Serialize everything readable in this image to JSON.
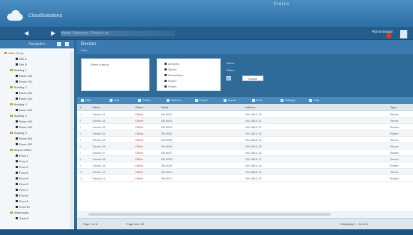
{
  "header": {
    "app_name": "CloudSolutions",
    "top_text": "Status",
    "nav_back": "◀",
    "nav_fwd": "▶",
    "breadcrumb": "Home / Inventory / Device List",
    "user": "Administrator"
  },
  "left_panel": {
    "title": "Navigation",
    "tree": [
      {
        "label": "Main Group",
        "kind": "folder",
        "indent": 0,
        "selected": true
      },
      {
        "label": "Site A",
        "kind": "node",
        "indent": 2
      },
      {
        "label": "Site B",
        "kind": "node",
        "indent": 2
      },
      {
        "label": "Building 1",
        "kind": "folder",
        "indent": 1
      },
      {
        "label": "Room 101",
        "kind": "node",
        "indent": 2
      },
      {
        "label": "Room 102",
        "kind": "node",
        "indent": 2
      },
      {
        "label": "Building 2",
        "kind": "folder",
        "indent": 1
      },
      {
        "label": "Room 201",
        "kind": "node",
        "indent": 2
      },
      {
        "label": "Room 202",
        "kind": "node",
        "indent": 2
      },
      {
        "label": "Building 3",
        "kind": "folder",
        "indent": 1
      },
      {
        "label": "Room 301",
        "kind": "node",
        "indent": 2
      },
      {
        "label": "Building 4",
        "kind": "folder",
        "indent": 1
      },
      {
        "label": "Room 401",
        "kind": "node",
        "indent": 2
      },
      {
        "label": "Room 402",
        "kind": "node",
        "indent": 2
      },
      {
        "label": "Building 5",
        "kind": "folder",
        "indent": 1
      },
      {
        "label": "Room 501",
        "kind": "node",
        "indent": 2
      },
      {
        "label": "Room 502",
        "kind": "node",
        "indent": 2
      },
      {
        "label": "Branch Office",
        "kind": "folder",
        "indent": 1
      },
      {
        "label": "Floor 1",
        "kind": "node",
        "indent": 2
      },
      {
        "label": "Floor 2",
        "kind": "node",
        "indent": 2
      },
      {
        "label": "Floor 3",
        "kind": "node",
        "indent": 2
      },
      {
        "label": "Floor 4",
        "kind": "node",
        "indent": 2
      },
      {
        "label": "Floor 5",
        "kind": "node",
        "indent": 2
      },
      {
        "label": "Floor 6",
        "kind": "node",
        "indent": 2
      },
      {
        "label": "Floor 7",
        "kind": "node",
        "indent": 2
      },
      {
        "label": "Floor 8",
        "kind": "node",
        "indent": 2
      },
      {
        "label": "Floor 9",
        "kind": "node",
        "indent": 2
      },
      {
        "label": "Floor 10",
        "kind": "node",
        "indent": 2
      },
      {
        "label": "Warehouse",
        "kind": "folder",
        "indent": 1
      },
      {
        "label": "Zone A",
        "kind": "node",
        "indent": 2
      }
    ]
  },
  "main": {
    "title": "Devices",
    "subtitle": "Filter",
    "filter_box1": "Select a group",
    "filter_box2_lines": [
      "All types",
      "Server",
      "Workstation",
      "Router",
      "Printer"
    ],
    "filter_label": "Name:",
    "filter_label2": "Status:",
    "filter_value": "Search",
    "toolbar": [
      "Add",
      "Edit",
      "Delete",
      "Refresh",
      "Export",
      "Import",
      "Print",
      "Settings",
      "Help"
    ],
    "columns": [
      "#",
      "Name",
      "Status",
      "Serial",
      "Address",
      "Type"
    ],
    "rows": [
      [
        "1",
        "Device 01",
        "Offline",
        "SN-0001",
        "192.168.1.10",
        "Server"
      ],
      [
        "2",
        "Device 02",
        "Offline",
        "SN-0002",
        "192.168.1.11",
        "Server"
      ],
      [
        "3",
        "Device 03",
        "Offline",
        "SN-0003",
        "192.168.1.12",
        "Router"
      ],
      [
        "4",
        "Device 04",
        "Offline",
        "SN-0004",
        "192.168.1.13",
        "Printer"
      ],
      [
        "5",
        "Device 05",
        "Offline",
        "SN-0005",
        "192.168.1.14",
        "Server"
      ],
      [
        "6",
        "Device 06",
        "Offline",
        "SN-0006",
        "192.168.1.15",
        "Server"
      ],
      [
        "7",
        "Device 07",
        "Offline",
        "SN-0007",
        "192.168.1.16",
        "Router"
      ],
      [
        "8",
        "Device 08",
        "Offline",
        "SN-0008",
        "192.168.1.17",
        "Server"
      ],
      [
        "9",
        "Device 09",
        "Offline",
        "SN-0009",
        "192.168.1.18",
        "Printer"
      ],
      [
        "10",
        "Device 10",
        "Offline",
        "SN-0010",
        "192.168.1.19",
        "Server"
      ],
      [
        "11",
        "Device 11",
        "Offline",
        "SN-0011",
        "192.168.1.20",
        "Router"
      ]
    ],
    "pager": {
      "page": "Page 1 of 1",
      "size": "Page size: 20",
      "range": "Displaying 1 - 11 of 11"
    }
  }
}
